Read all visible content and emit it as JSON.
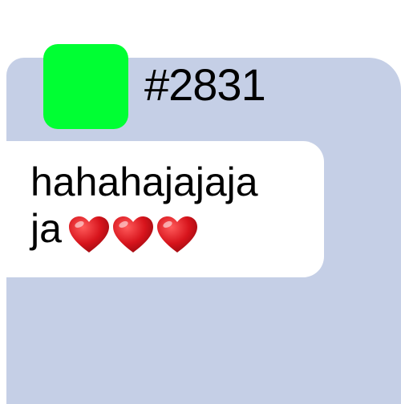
{
  "header": {
    "sender_id": "#2831",
    "avatar_color": "#00ff33"
  },
  "message": {
    "line1": "hahahajajaja",
    "line2": "ja",
    "emoji": [
      "heart-emoji",
      "heart-emoji",
      "heart-emoji"
    ],
    "bubble_color": "#ffffff"
  },
  "colors": {
    "panel_background": "#c5cfe6",
    "heart_red": "#d7141c"
  }
}
